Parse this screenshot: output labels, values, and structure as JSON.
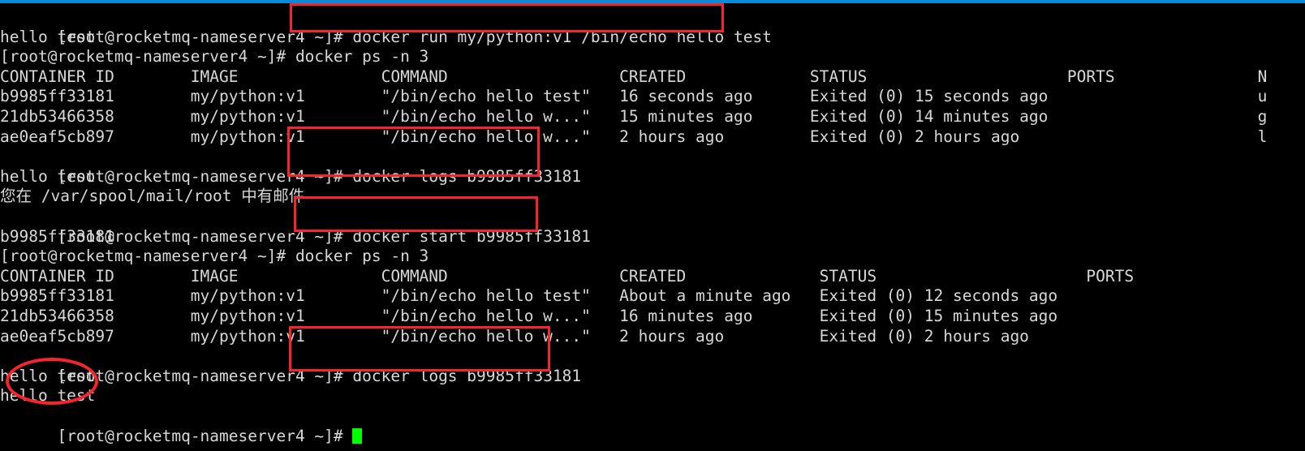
{
  "terminal": {
    "prompt": "[root@rocketmq-nameserver4 ~]# ",
    "cursor_color": "#00ff00",
    "text_color": "#d8d8d8",
    "background": "#000000",
    "top_bar_color": "#0b8ad8",
    "annotation_color": "#f5252c"
  },
  "lines": {
    "l01_prompt": "[root@rocketmq-nameserver4 ~]# ",
    "l01_cmd": "docker run my/python:v1 /bin/echo hello test",
    "l02": "hello test",
    "l03": "[root@rocketmq-nameserver4 ~]# docker ps -n 3",
    "l04": "CONTAINER ID        IMAGE               COMMAND                  CREATED             STATUS                     PORTS               N",
    "l05": "b9985ff33181        my/python:v1        \"/bin/echo hello test\"   16 seconds ago      Exited (0) 15 seconds ago                      u",
    "l06": "21db53466358        my/python:v1        \"/bin/echo hello w...\"   15 minutes ago      Exited (0) 14 minutes ago                      g",
    "l07": "ae0eaf5cb897        my/python:v1        \"/bin/echo hello w...\"   2 hours ago         Exited (0) 2 hours ago                         l",
    "l08_prompt": "[root@rocketmq-nameserver4 ~]# ",
    "l08_cmd": "docker logs b9985ff33181",
    "l09": "hello test",
    "l10": "您在 /var/spool/mail/root 中有邮件",
    "l11_prompt": "[root@rocketmq-nameserver4 ~]# ",
    "l11_cmd": "docker start b9985ff33181",
    "l12": "b9985ff33181",
    "l13": "[root@rocketmq-nameserver4 ~]# docker ps -n 3",
    "l14": "CONTAINER ID        IMAGE               COMMAND                  CREATED              STATUS                      PORTS",
    "l15": "b9985ff33181        my/python:v1        \"/bin/echo hello test\"   About a minute ago   Exited (0) 12 seconds ago",
    "l16": "21db53466358        my/python:v1        \"/bin/echo hello w...\"   16 minutes ago       Exited (0) 15 minutes ago",
    "l17": "ae0eaf5cb897        my/python:v1        \"/bin/echo hello w...\"   2 hours ago          Exited (0) 2 hours ago",
    "l18_prompt": "[root@rocketmq-nameserver4 ~]# ",
    "l18_cmd": "docker logs b9985ff33181",
    "l19": "hello test",
    "l20": "hello test",
    "l21_prompt": "[root@rocketmq-nameserver4 ~]# "
  },
  "tables": {
    "first": {
      "headers": [
        "CONTAINER ID",
        "IMAGE",
        "COMMAND",
        "CREATED",
        "STATUS",
        "PORTS",
        "NAMES"
      ],
      "rows": [
        [
          "b9985ff33181",
          "my/python:v1",
          "\"/bin/echo hello test\"",
          "16 seconds ago",
          "Exited (0) 15 seconds ago",
          "",
          "u"
        ],
        [
          "21db53466358",
          "my/python:v1",
          "\"/bin/echo hello w...\"",
          "15 minutes ago",
          "Exited (0) 14 minutes ago",
          "",
          "g"
        ],
        [
          "ae0eaf5cb897",
          "my/python:v1",
          "\"/bin/echo hello w...\"",
          "2 hours ago",
          "Exited (0) 2 hours ago",
          "",
          "l"
        ]
      ]
    },
    "second": {
      "headers": [
        "CONTAINER ID",
        "IMAGE",
        "COMMAND",
        "CREATED",
        "STATUS",
        "PORTS"
      ],
      "rows": [
        [
          "b9985ff33181",
          "my/python:v1",
          "\"/bin/echo hello test\"",
          "About a minute ago",
          "Exited (0) 12 seconds ago",
          ""
        ],
        [
          "21db53466358",
          "my/python:v1",
          "\"/bin/echo hello w...\"",
          "16 minutes ago",
          "Exited (0) 15 minutes ago",
          ""
        ],
        [
          "ae0eaf5cb897",
          "my/python:v1",
          "\"/bin/echo hello w...\"",
          "2 hours ago",
          "Exited (0) 2 hours ago",
          ""
        ]
      ]
    }
  },
  "annotations": {
    "box_docker_run": "docker run my/python:v1 /bin/echo hello test",
    "box_docker_logs_1": "docker logs b9985ff33181",
    "box_docker_start": "docker start b9985ff33181",
    "box_docker_logs_2": "docker logs b9985ff33181",
    "ellipse_hello_test": "hello test / hello test"
  }
}
